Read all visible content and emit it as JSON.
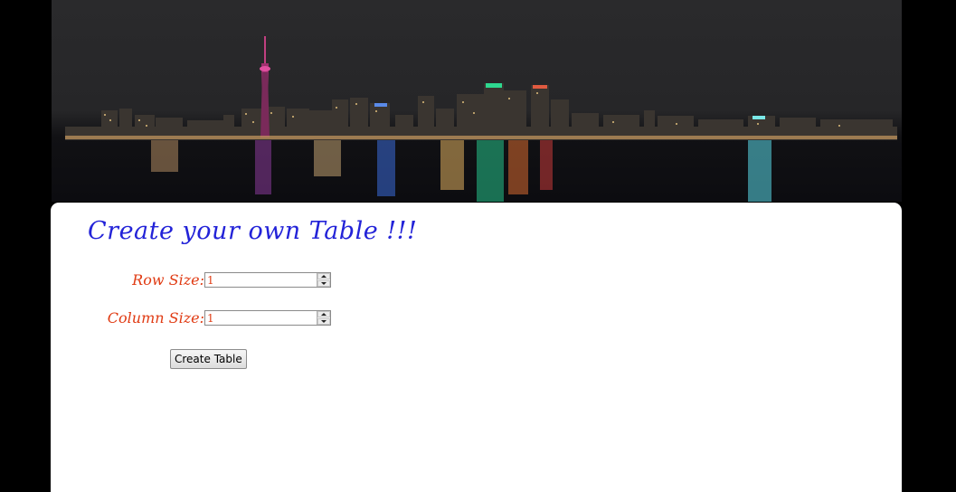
{
  "banner": {
    "alt": "Toronto skyline at night"
  },
  "form": {
    "title": "Create your own Table !!!",
    "row_size": {
      "label": "Row Size:",
      "value": "1"
    },
    "column_size": {
      "label": "Column Size:",
      "value": "1"
    },
    "submit_label": "Create Table"
  },
  "colors": {
    "background": "#000000",
    "panel": "#ffffff",
    "title": "#2323d8",
    "label": "#e03a12"
  }
}
